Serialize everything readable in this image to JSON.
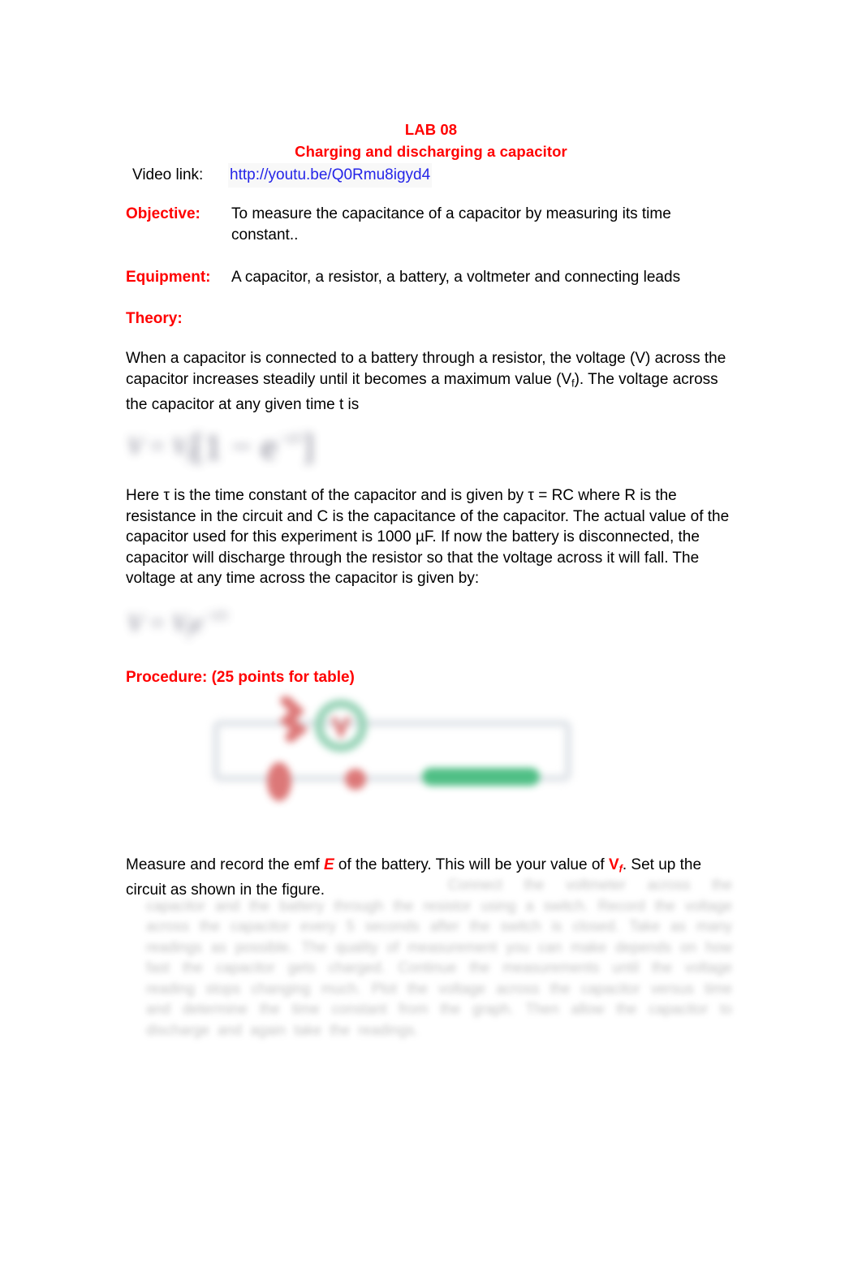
{
  "document": {
    "title": "LAB 08",
    "subtitle": "Charging and discharging a capacitor"
  },
  "video": {
    "label": "Video link:",
    "url": "http://youtu.be/Q0Rmu8igyd4"
  },
  "objective": {
    "label": "Objective:",
    "text": "To measure the capacitance of a capacitor by measuring its time constant.."
  },
  "equipment": {
    "label": "Equipment:",
    "text": "A capacitor, a resistor, a battery, a voltmeter and connecting leads"
  },
  "theory": {
    "heading": "Theory:",
    "paragraph_1_part_1": "When a capacitor is connected to a battery through a resistor, the voltage (V) across the capacitor increases steadily until it becomes a maximum value (V",
    "paragraph_1_subscript": "f",
    "paragraph_1_part_2": "). The voltage across the capacitor at any given time t is",
    "equation_charging": "V = V",
    "equation_charging_sub": "f",
    "equation_charging_rest": "[1 − e",
    "equation_charging_exp": "−t/τ",
    "equation_charging_end": "]",
    "paragraph_2": "Here τ is the time constant of the capacitor and is given by τ = RC where R is the resistance in the circuit and C is the capacitance of the capacitor. The actual value of the capacitor used for this experiment is 1000 µF. If now the battery is disconnected, the capacitor will discharge through the resistor so that the voltage across it will fall. The voltage at any time across the capacitor is given by:",
    "equation_discharging": "V = V",
    "equation_discharging_sub": "f",
    "equation_discharging_rest": "e",
    "equation_discharging_exp": "−t/τ"
  },
  "procedure": {
    "heading": "Procedure: (25 points for table)",
    "closing_part_1": "Measure and record the emf ",
    "closing_emf_symbol": "E",
    "closing_part_2": " of the battery. This will be your value of ",
    "closing_vf_symbol": "V",
    "closing_vf_subscript": "f",
    "closing_part_3": ". Set up the circuit as shown in the figure.",
    "blurred_tail_note": "(remaining text is blurred and illegible)"
  },
  "figure": {
    "caption": "circuit diagram (blurred)",
    "wire_color": "#dfe3e8",
    "annotation_color": "#d96a6a",
    "voltmeter_color": "#6fc69a",
    "battery_color": "#3cb878"
  },
  "colors": {
    "heading_red": "#ff0000",
    "link_blue": "#2525e8",
    "body_black": "#000000",
    "page_background": "#ffffff"
  }
}
